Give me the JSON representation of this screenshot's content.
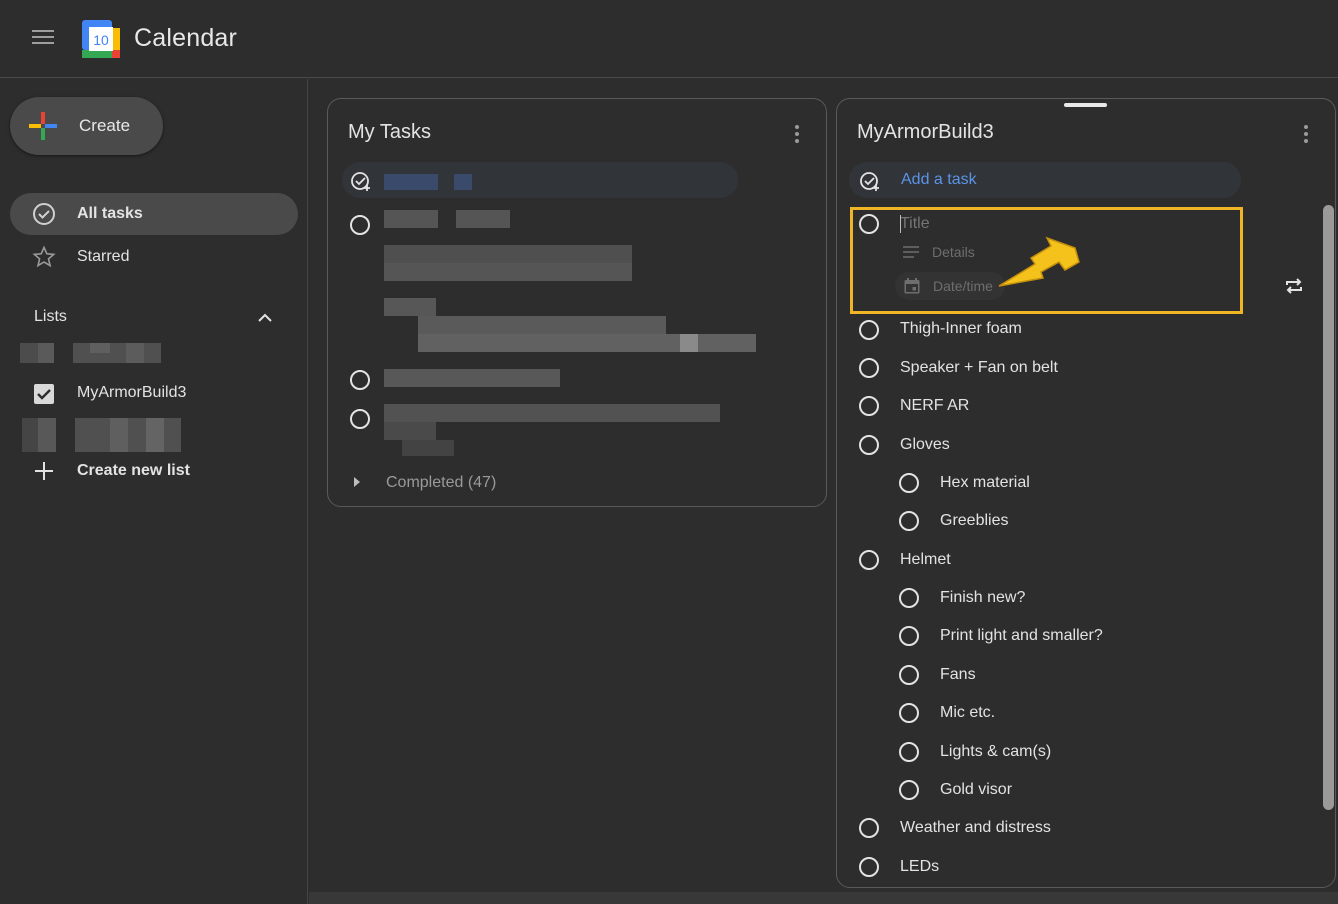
{
  "header": {
    "app_title": "Calendar",
    "logo_day": "10"
  },
  "sidebar": {
    "create_label": "Create",
    "nav": [
      {
        "label": "All tasks",
        "active": true
      },
      {
        "label": "Starred",
        "active": false
      }
    ],
    "lists_heading": "Lists",
    "lists": [
      {
        "label": "MyArmorBuild3",
        "checked": true
      }
    ],
    "create_new_list_label": "Create new list"
  },
  "my_tasks": {
    "title": "My Tasks",
    "completed_label": "Completed (47)"
  },
  "armor_list": {
    "title": "MyArmorBuild3",
    "add_task_label": "Add a task",
    "new_task": {
      "title_placeholder": "Title",
      "details_placeholder": "Details",
      "datetime_placeholder": "Date/time"
    },
    "tasks": [
      "Thigh-Inner foam",
      "Speaker + Fan on belt",
      "NERF AR",
      "Gloves",
      "Hex material",
      "Greeblies",
      "Helmet",
      "Finish new?",
      "Print light and smaller?",
      "Fans",
      "Mic etc.",
      "Lights & cam(s)",
      "Gold visor",
      "Weather and distress",
      "LEDs"
    ]
  },
  "colors": {
    "accent_blue": "#5b93e6",
    "highlight_box": "#f0b525",
    "annotation_arrow": "#f4c21b",
    "background": "#2d2d2d"
  }
}
